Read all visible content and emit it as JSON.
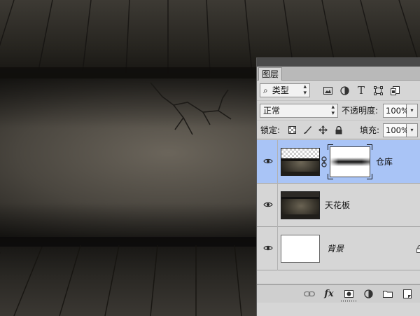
{
  "panel": {
    "tab_label": "图层",
    "filter": {
      "selected": "类型",
      "search_icon": "search-icon"
    },
    "filter_icons": [
      "image-filter-icon",
      "adjustment-filter-icon",
      "type-filter-icon",
      "shape-filter-icon",
      "smart-object-filter-icon"
    ],
    "blend_mode": "正常",
    "opacity_label": "不透明度:",
    "opacity_value": "100%",
    "lock_label": "锁定:",
    "lock_icons": [
      "lock-transparent-icon",
      "lock-image-icon",
      "lock-position-icon",
      "lock-all-icon"
    ],
    "fill_label": "填充:",
    "fill_value": "100%",
    "layers": [
      {
        "name": "仓库",
        "visible": true,
        "selected": true,
        "has_mask": true
      },
      {
        "name": "天花板",
        "visible": true,
        "selected": false,
        "has_mask": false
      },
      {
        "name": "背景",
        "visible": true,
        "selected": false,
        "locked": true
      }
    ],
    "footer_icons": [
      "link-layers-icon",
      "fx-icon",
      "add-mask-icon",
      "adjustment-layer-icon",
      "new-group-icon",
      "new-layer-icon",
      "delete-icon"
    ],
    "fx_label": "fx"
  },
  "colors": {
    "panel_bg": "#d6d6d6",
    "selected_layer": "#a9c4f6",
    "canvas_bg": "#1b1915"
  }
}
